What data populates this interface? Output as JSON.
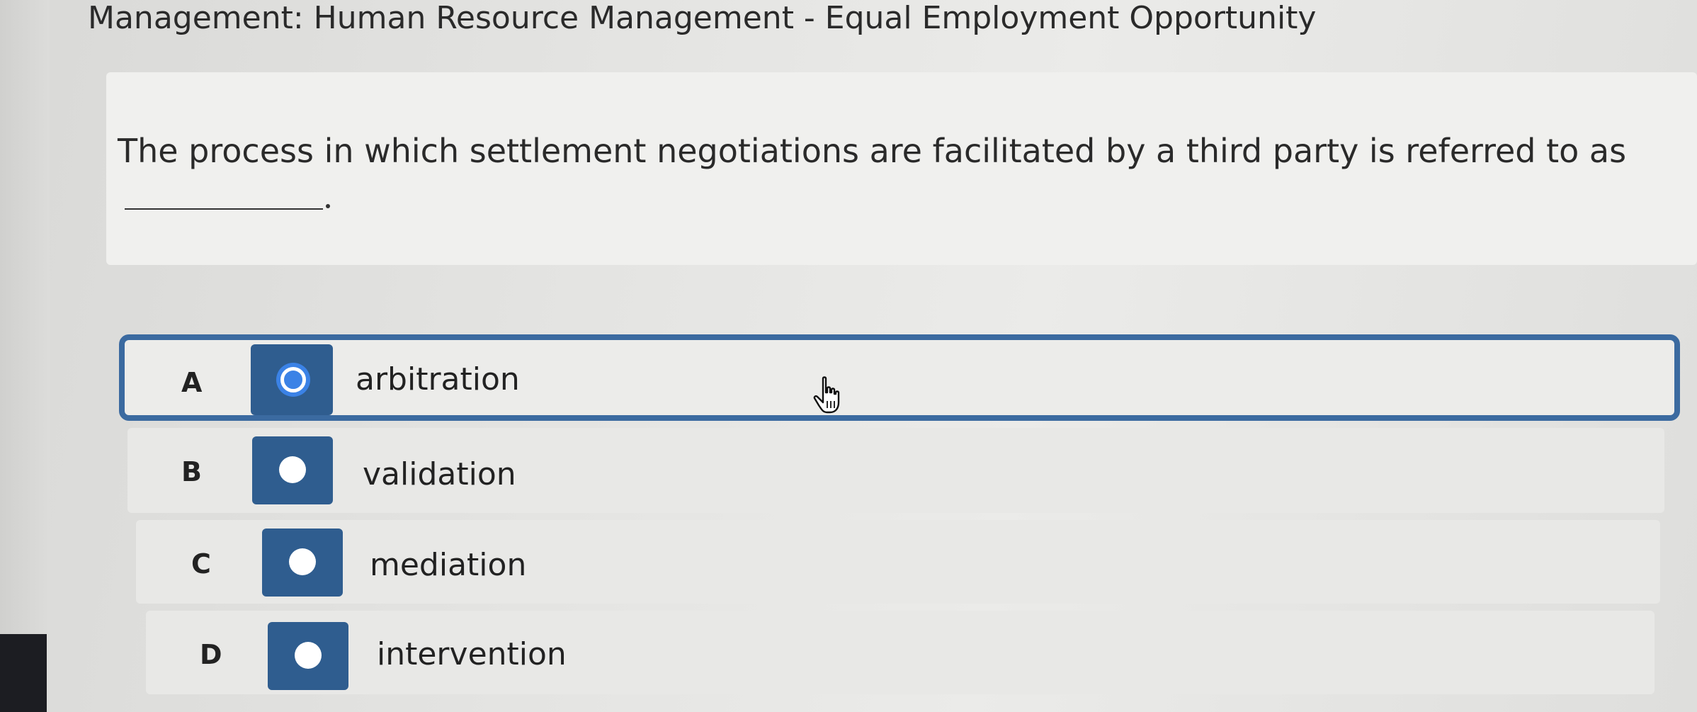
{
  "header": {
    "breadcrumb": "Management: Human Resource Management - Equal Employment Opportunity"
  },
  "question": {
    "text": "The process in which settlement negotiations are facilitated by a third party is referred to as"
  },
  "options": [
    {
      "letter": "A",
      "label": "arbitration",
      "selected": true
    },
    {
      "letter": "B",
      "label": "validation",
      "selected": false
    },
    {
      "letter": "C",
      "label": "mediation",
      "selected": false
    },
    {
      "letter": "D",
      "label": "intervention",
      "selected": false
    }
  ],
  "colors": {
    "accent": "#2f5d8f",
    "selected_border": "#3b6aa0",
    "radio_focus": "#3b82e6"
  },
  "icons": {
    "cursor": "hand-pointer-icon"
  }
}
